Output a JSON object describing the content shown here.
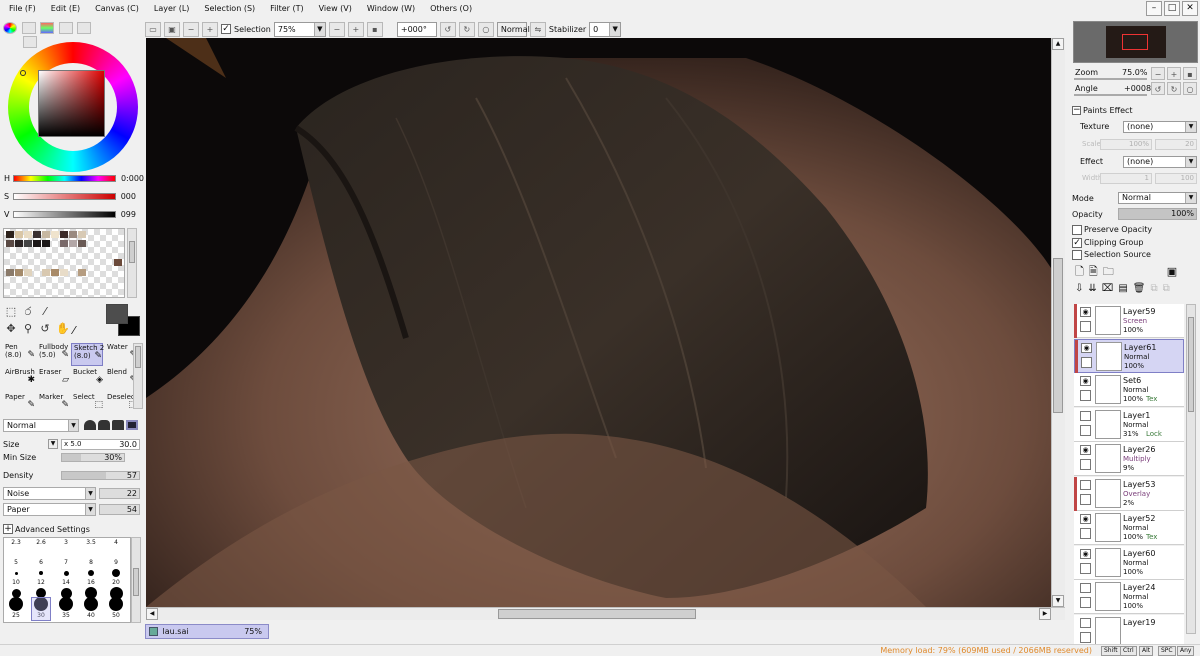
{
  "menu": [
    "File (F)",
    "Edit (E)",
    "Canvas (C)",
    "Layer (L)",
    "Selection (S)",
    "Filter (T)",
    "View (V)",
    "Window (W)",
    "Others (O)"
  ],
  "window_controls": [
    "–",
    "□",
    "✕"
  ],
  "toolbar": {
    "selection_label": "Selection",
    "selection_checked": true,
    "zoom": "75%",
    "angle": "+000°",
    "blend_mode": "Normal",
    "stabilizer_label": "Stabilizer",
    "stabilizer_value": "0"
  },
  "color": {
    "h_label": "H",
    "h_value": "0:000",
    "s_label": "S",
    "s_value": "000",
    "v_label": "V",
    "v_value": "099",
    "fg": "#4d4d4d",
    "bg": "#000000"
  },
  "brushes": [
    {
      "name": "Pen",
      "size": "(8.0)"
    },
    {
      "name": "Fullbody",
      "size": "(5.0)"
    },
    {
      "name": "Sketch 2",
      "size": "(8.0)",
      "selected": true
    },
    {
      "name": "Water",
      "size": ""
    },
    {
      "name": "AirBrush",
      "size": ""
    },
    {
      "name": "Eraser",
      "size": ""
    },
    {
      "name": "Bucket",
      "size": ""
    },
    {
      "name": "Blend",
      "size": ""
    },
    {
      "name": "Paper",
      "size": ""
    },
    {
      "name": "Marker",
      "size": ""
    },
    {
      "name": "Select",
      "size": ""
    },
    {
      "name": "Deselect",
      "size": ""
    }
  ],
  "brush_props": {
    "mode": "Normal",
    "size_label": "Size",
    "size_mult": "x 5.0",
    "size_value": "30.0",
    "minsize_label": "Min Size",
    "minsize_value": "30%",
    "minsize_fraction": 0.3,
    "density_label": "Density",
    "density_value": "57",
    "density_fraction": 0.57,
    "noise_type": "Noise",
    "noise_value": "22",
    "texture_type": "Paper",
    "texture_value": "54",
    "advanced_label": "Advanced Settings"
  },
  "brush_sizes": [
    "2.3",
    "2.6",
    "3",
    "3.5",
    "4",
    "5",
    "6",
    "7",
    "8",
    "9",
    "10",
    "12",
    "14",
    "16",
    "20",
    "25",
    "30",
    "35",
    "40",
    "50"
  ],
  "file_tab": {
    "name": "lau.sai",
    "zoom": "75%"
  },
  "navigator": {
    "zoom_label": "Zoom",
    "zoom_value": "75.0%",
    "angle_label": "Angle",
    "angle_value": "+0008"
  },
  "paints_effect": {
    "title": "Paints Effect",
    "texture_label": "Texture",
    "texture_value": "(none)",
    "scale_label": "Scale",
    "scale_value": "100%",
    "scale_num": "20",
    "effect_label": "Effect",
    "effect_value": "(none)",
    "width_label": "Width",
    "width_value": "1",
    "width_num": "100"
  },
  "layer_props": {
    "mode_label": "Mode",
    "mode_value": "Normal",
    "opacity_label": "Opacity",
    "opacity_value": "100%",
    "preserve_opacity": "Preserve Opacity",
    "clipping_group": "Clipping Group",
    "selection_source": "Selection Source"
  },
  "layers": [
    {
      "name": "Layer59",
      "mode": "Screen",
      "opacity": "100%",
      "tag": "",
      "visible": true,
      "clip": true,
      "mode_color": "#7a3d7a"
    },
    {
      "name": "Layer61",
      "mode": "Normal",
      "opacity": "100%",
      "tag": "",
      "visible": true,
      "clip": true,
      "selected": true,
      "mode_color": "#111111"
    },
    {
      "name": "Set6",
      "mode": "Normal",
      "opacity": "100%",
      "tag": "Tex",
      "visible": true,
      "clip": false,
      "mode_color": "#111111"
    },
    {
      "name": "Layer1",
      "mode": "Normal",
      "opacity": "31%",
      "tag": "Lock",
      "visible": false,
      "clip": false,
      "mode_color": "#111111"
    },
    {
      "name": "Layer26",
      "mode": "Multiply",
      "opacity": "9%",
      "tag": "",
      "visible": true,
      "clip": false,
      "mode_color": "#7a3d7a"
    },
    {
      "name": "Layer53",
      "mode": "Overlay",
      "opacity": "2%",
      "tag": "",
      "visible": false,
      "clip": true,
      "mode_color": "#7a3d7a"
    },
    {
      "name": "Layer52",
      "mode": "Normal",
      "opacity": "100%",
      "tag": "Tex",
      "visible": true,
      "clip": false,
      "mode_color": "#111111"
    },
    {
      "name": "Layer60",
      "mode": "Normal",
      "opacity": "100%",
      "tag": "",
      "visible": true,
      "clip": false,
      "mode_color": "#111111"
    },
    {
      "name": "Layer24",
      "mode": "Normal",
      "opacity": "100%",
      "tag": "",
      "visible": false,
      "clip": false,
      "mode_color": "#111111"
    },
    {
      "name": "Layer19",
      "mode": "",
      "opacity": "",
      "tag": "",
      "visible": false,
      "clip": false,
      "mode_color": "#111111"
    }
  ],
  "status": {
    "memory": "Memory load: 79% (609MB used / 2066MB reserved)",
    "keys": [
      "Shift",
      "Ctrl",
      "Alt",
      "SPC",
      "Any"
    ]
  }
}
